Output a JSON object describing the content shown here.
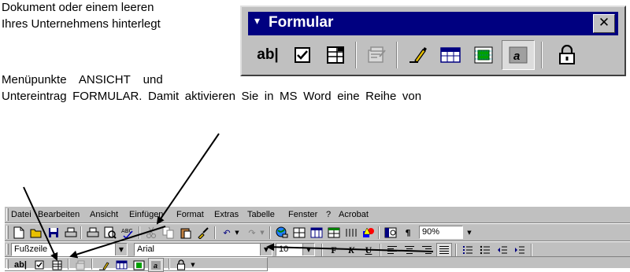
{
  "document": {
    "line1": "Dokument oder einem leeren",
    "line2": "Ihres Unternehmens hinterlegt",
    "line3": "Menüpunkte ANSICHT und",
    "line4": "Untereintrag FORMULAR. Damit aktivieren Sie in MS Word eine Reihe von"
  },
  "formular_toolbar": {
    "title": "Formular",
    "menu_caret": "▾",
    "close_glyph": "✕",
    "buttons": [
      {
        "name": "textfield-icon",
        "label": "ab|"
      },
      {
        "name": "checkbox-icon"
      },
      {
        "name": "dropdown-field-icon"
      },
      {
        "name": "field-options-icon"
      },
      {
        "name": "draw-table-icon"
      },
      {
        "name": "insert-table-icon"
      },
      {
        "name": "insert-frame-icon"
      },
      {
        "name": "field-shading-icon",
        "pressed": true
      },
      {
        "name": "protect-form-icon"
      }
    ]
  },
  "word": {
    "menu": [
      "Datei",
      "Bearbeiten",
      "Ansicht",
      "Einfügen",
      "Format",
      "Extras",
      "Tabelle",
      "Fenster",
      "?",
      "Acrobat"
    ],
    "style_combo": "Fußzeile",
    "font_combo": "Arial",
    "size_combo": "10",
    "zoom_combo": "90%",
    "bold": "F",
    "italic": "K",
    "underline": "U",
    "pilcrow": "¶",
    "form_textfield": "ab|"
  }
}
